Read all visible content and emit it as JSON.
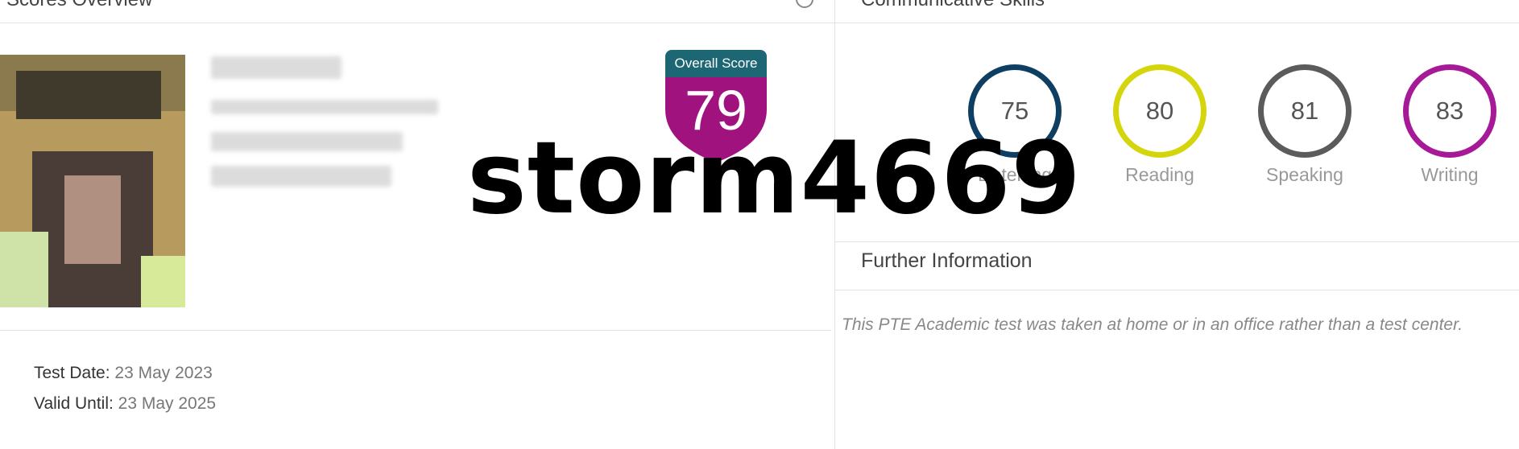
{
  "left_panel": {
    "title": "Scores Overview"
  },
  "right_panel": {
    "title": "Communicative Skills"
  },
  "overall": {
    "label": "Overall Score",
    "score": "79",
    "color": "#a0127e",
    "header_color": "#1d6673"
  },
  "test_info": {
    "test_date_label": "Test Date:",
    "test_date": "23 May 2023",
    "valid_until_label": "Valid Until:",
    "valid_until": "23 May 2025"
  },
  "skills": [
    {
      "name": "Listening",
      "score": "75",
      "color": "#0f3e63"
    },
    {
      "name": "Reading",
      "score": "80",
      "color": "#d4d60b"
    },
    {
      "name": "Speaking",
      "score": "81",
      "color": "#5b5b5b"
    },
    {
      "name": "Writing",
      "score": "83",
      "color": "#a61a98"
    }
  ],
  "further": {
    "title": "Further Information",
    "note": "This PTE Academic test was taken at home or in an office rather than a test center."
  },
  "watermark": "storm4669"
}
